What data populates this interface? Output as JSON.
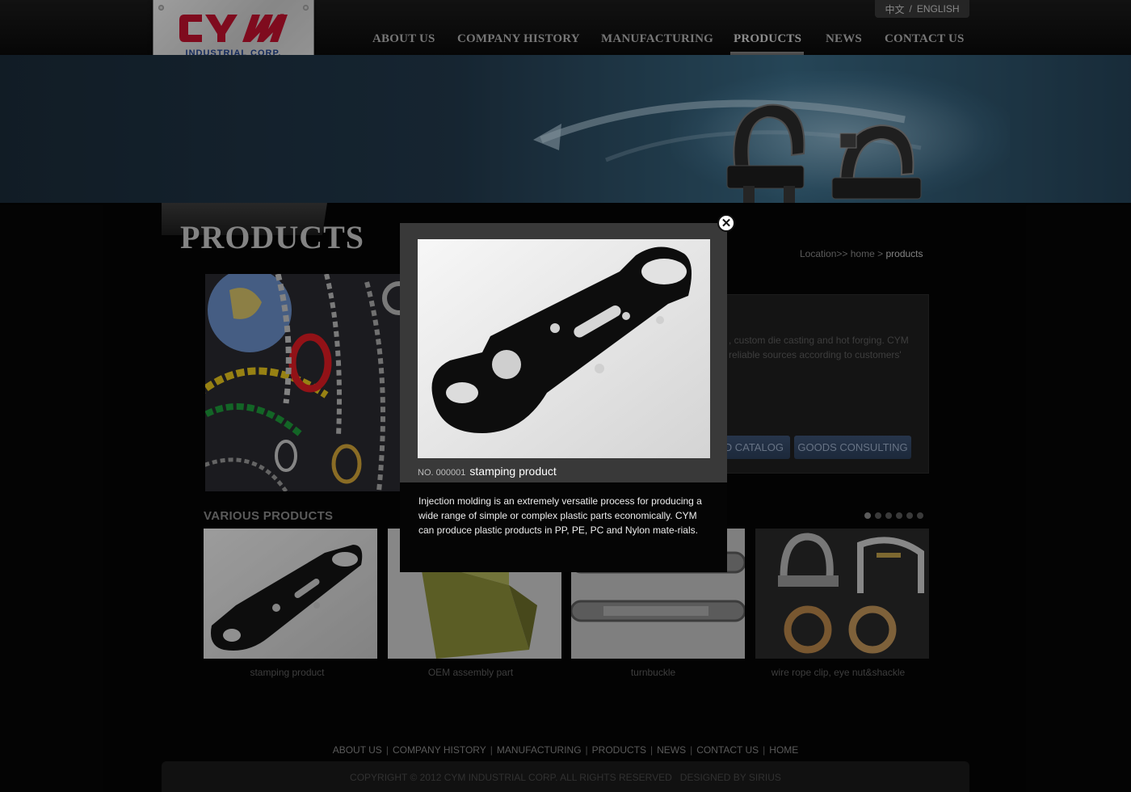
{
  "header": {
    "logo_text": "CYM",
    "logo_reg": "®",
    "logo_subtitle": "INDUSTRIAL  CORP.",
    "lang": {
      "chinese": "中文",
      "separator": "/",
      "english": "ENGLISH"
    },
    "nav": [
      {
        "label": "ABOUT US"
      },
      {
        "label": "COMPANY HISTORY"
      },
      {
        "label": "MANUFACTURING"
      },
      {
        "label": "PRODUCTS",
        "active": true
      },
      {
        "label": "NEWS"
      },
      {
        "label": "CONTACT US"
      }
    ]
  },
  "page": {
    "title": "PRODUCTS",
    "breadcrumb": {
      "prefix": "Location>>",
      "home": "home",
      "sep": ">",
      "current": "products"
    },
    "info_text": ", custom die casting and hot forging.  CYM\nreliable sources according to customers'",
    "buttons": {
      "catalog": "AD CATALOG",
      "consulting": "GOODS CONSULTING"
    }
  },
  "various": {
    "title": "VARIOUS PRODUCTS",
    "dots_count": 6,
    "active_dot": 1,
    "items": [
      {
        "label": "stamping product"
      },
      {
        "label": "OEM assembly part"
      },
      {
        "label": "turnbuckle"
      },
      {
        "label": "wire rope clip, eye nut&shackle"
      }
    ]
  },
  "modal": {
    "number_prefix": "NO. 000001",
    "name": "stamping product",
    "description": "Injection molding is an extremely versatile process for producing a wide range of simple or complex plastic parts economically. CYM can produce plastic products in PP, PE, PC and Nylon mate-rials.",
    "close_glyph": "✕"
  },
  "footer": {
    "links": [
      "ABOUT US",
      "COMPANY HISTORY",
      "MANUFACTURING",
      "PRODUCTS",
      "NEWS",
      "CONTACT US",
      "HOME"
    ],
    "separator": "|",
    "copyright": "COPYRIGHT © 2012 CYM INDUSTRIAL CORP. ALL RIGHTS RESERVED   DESIGNED BY SIRIUS"
  },
  "colors": {
    "brand_red": "#c4122f",
    "brand_blue": "#1d3f8c",
    "button_blue": "#2c3f5b"
  }
}
